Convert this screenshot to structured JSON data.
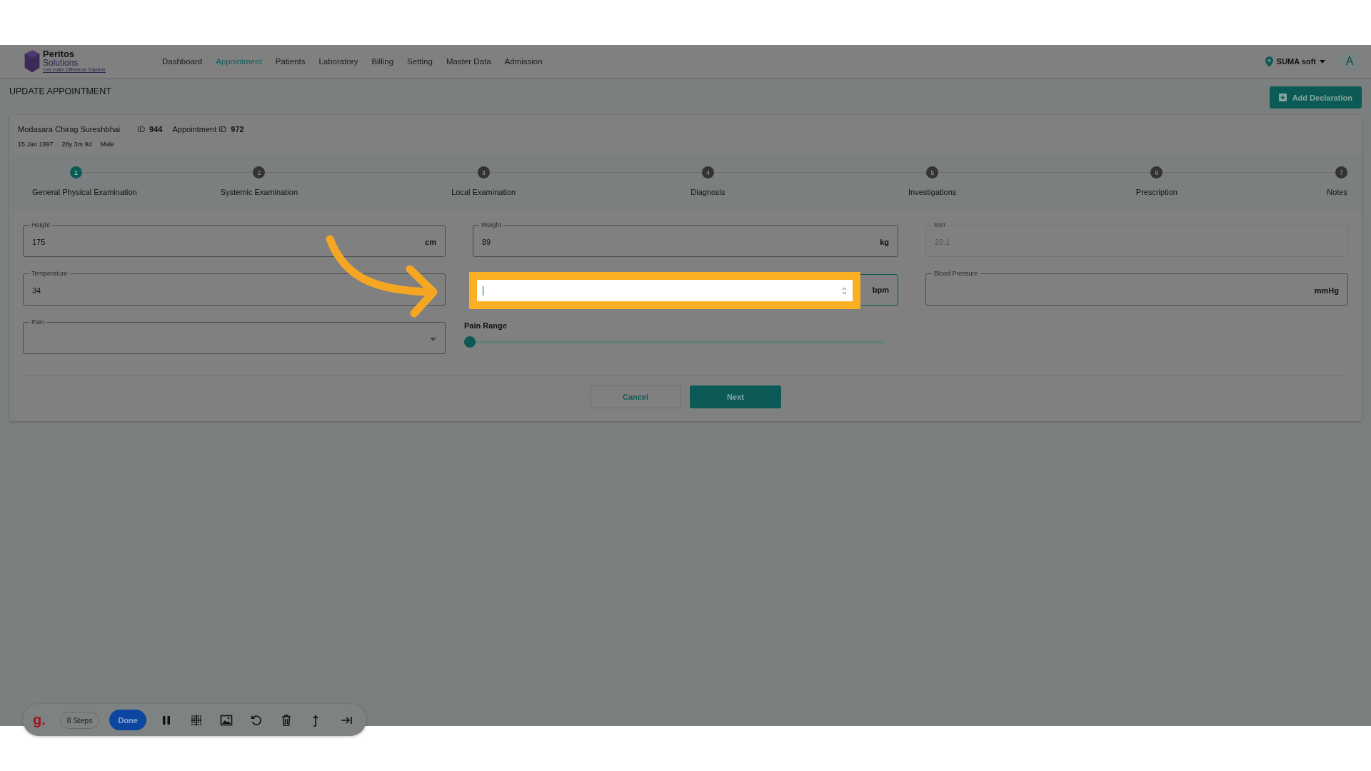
{
  "header": {
    "logo": {
      "name": "Peritos",
      "sub": "Solutions",
      "tagline": "Lets make Difference Together"
    },
    "nav": [
      {
        "label": "Dashboard",
        "selected": false
      },
      {
        "label": "Appointment",
        "selected": true
      },
      {
        "label": "Patients",
        "selected": false
      },
      {
        "label": "Laboratory",
        "selected": false
      },
      {
        "label": "Billing",
        "selected": false
      },
      {
        "label": "Setting",
        "selected": false
      },
      {
        "label": "Master Data",
        "selected": false
      },
      {
        "label": "Admission",
        "selected": false
      }
    ],
    "location": "SUMA soft",
    "avatar": "A"
  },
  "page_title": "UPDATE APPOINTMENT",
  "add_button": "Add Declaration",
  "patient": {
    "name": "Modasara Chirag Sureshbhai",
    "id_label": "ID",
    "id": "944",
    "appointment_label": "Appointment ID",
    "appointment_id": "972",
    "dob": "15 Jan 1997",
    "age": "28y 3m 9d",
    "gender": "Male"
  },
  "steps": [
    {
      "number": "1",
      "label": "General Physical Examination",
      "selected": true
    },
    {
      "number": "2",
      "label": "Systemic Examination",
      "selected": false
    },
    {
      "number": "3",
      "label": "Local Examination",
      "selected": false
    },
    {
      "number": "4",
      "label": "Diagnosis",
      "selected": false
    },
    {
      "number": "5",
      "label": "Investigations",
      "selected": false
    },
    {
      "number": "6",
      "label": "Prescription",
      "selected": false
    },
    {
      "number": "7",
      "label": "Notes",
      "selected": false
    }
  ],
  "fields": [
    {
      "kind": "text",
      "label": "Height",
      "value": "175",
      "unit": "cm"
    },
    {
      "kind": "text",
      "label": "Weight",
      "value": "89",
      "unit": "kg"
    },
    {
      "kind": "text",
      "label": "BMI",
      "value": "29.1",
      "disabled": true
    },
    {
      "kind": "text",
      "label": "Temperature",
      "value": "34"
    },
    {
      "kind": "number",
      "unit": "bpm",
      "highlighted": true
    },
    {
      "kind": "text",
      "label": "Blood Pressure",
      "unit": "mmHg"
    },
    {
      "kind": "select",
      "label": "Pain"
    },
    {
      "kind": "slider",
      "label": "Pain Range",
      "level": 0
    }
  ],
  "buttons": [
    "Cancel",
    "Next"
  ],
  "recorder": {
    "steps": "8 Steps",
    "done": "Done",
    "logo": "g."
  }
}
